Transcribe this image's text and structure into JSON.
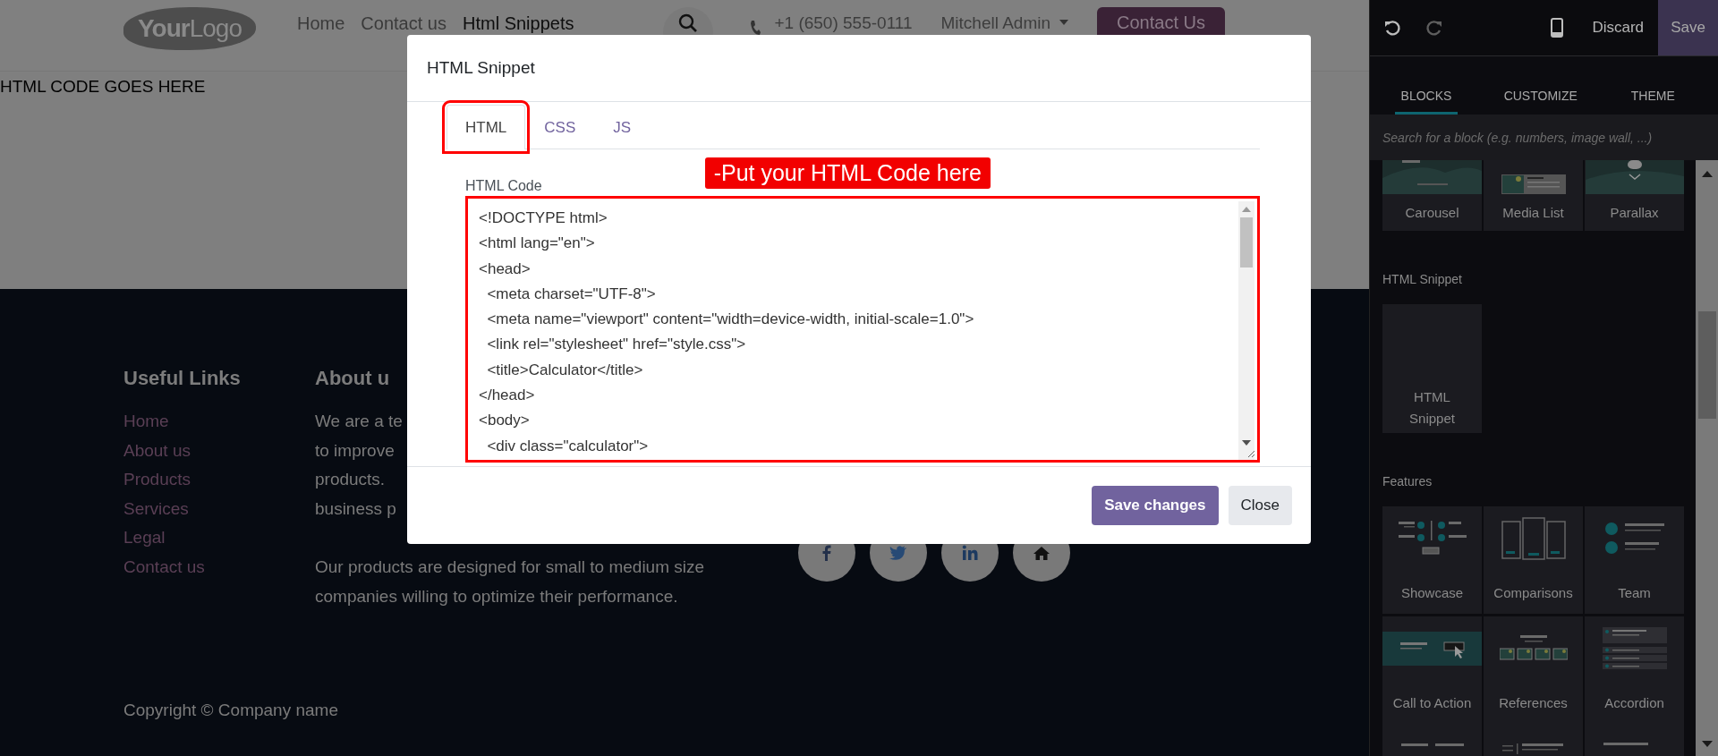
{
  "header": {
    "logo": "**Your**Logo",
    "nav": [
      {
        "label": "Home",
        "selected": false
      },
      {
        "label": "Contact us",
        "selected": false
      },
      {
        "label": "Html Snippets",
        "selected": true
      }
    ],
    "phone": "+1 (650) 555-0111",
    "user": "Mitchell Admin",
    "cta": "Contact Us"
  },
  "page_text": "HTML CODE GOES HERE",
  "footer": {
    "links_title": "Useful Links",
    "links": [
      "Home",
      "About us",
      "Products",
      "Services",
      "Legal",
      "Contact us"
    ],
    "about_title": "About u",
    "about_lines": [
      "We are a te",
      "to improve",
      "products.",
      "business p"
    ],
    "about_paragraph": [
      "Our products are designed for small to medium size",
      "companies willing to optimize their performance."
    ],
    "copyright": "Copyright © Company name"
  },
  "modal": {
    "title": "HTML Snippet",
    "tabs": [
      {
        "label": "HTML",
        "selected": true,
        "highlighted": true
      },
      {
        "label": "CSS",
        "selected": false,
        "highlighted": false
      },
      {
        "label": "JS",
        "selected": false,
        "highlighted": false
      }
    ],
    "field_label": "HTML Code",
    "callout": "-Put your HTML Code here",
    "editor_highlighted": true,
    "code_lines": [
      "<!DOCTYPE html>",
      "<html lang=\"en\">",
      "<head>",
      "  <meta charset=\"UTF-8\">",
      "  <meta name=\"viewport\" content=\"width=device-width, initial-scale=1.0\">",
      "  <link rel=\"stylesheet\" href=\"style.css\">",
      "  <title>Calculator</title>",
      "</head>",
      "<body>",
      "  <div class=\"calculator\">"
    ],
    "buttons": [
      {
        "label": "Save changes",
        "kind": "primary"
      },
      {
        "label": "Close",
        "kind": "secondary"
      }
    ]
  },
  "panel": {
    "discard": "Discard",
    "save": "Save",
    "tabs": [
      {
        "label": "BLOCKS",
        "selected": true
      },
      {
        "label": "CUSTOMIZE",
        "selected": false
      },
      {
        "label": "THEME",
        "selected": false
      }
    ],
    "search_placeholder": "Search for a block (e.g. numbers, image wall, ...)",
    "sections": [
      {
        "kind": "partial",
        "blocks": [
          "Carousel",
          "Media List",
          "Parallax"
        ]
      },
      {
        "kind": "tall",
        "title": "HTML Snippet",
        "blocks": [
          "HTML Snippet"
        ]
      },
      {
        "kind": "normal",
        "title": "Features",
        "blocks": [
          "Showcase",
          "Comparisons",
          "Team",
          "Call to Action",
          "References",
          "Accordion"
        ]
      }
    ]
  }
}
